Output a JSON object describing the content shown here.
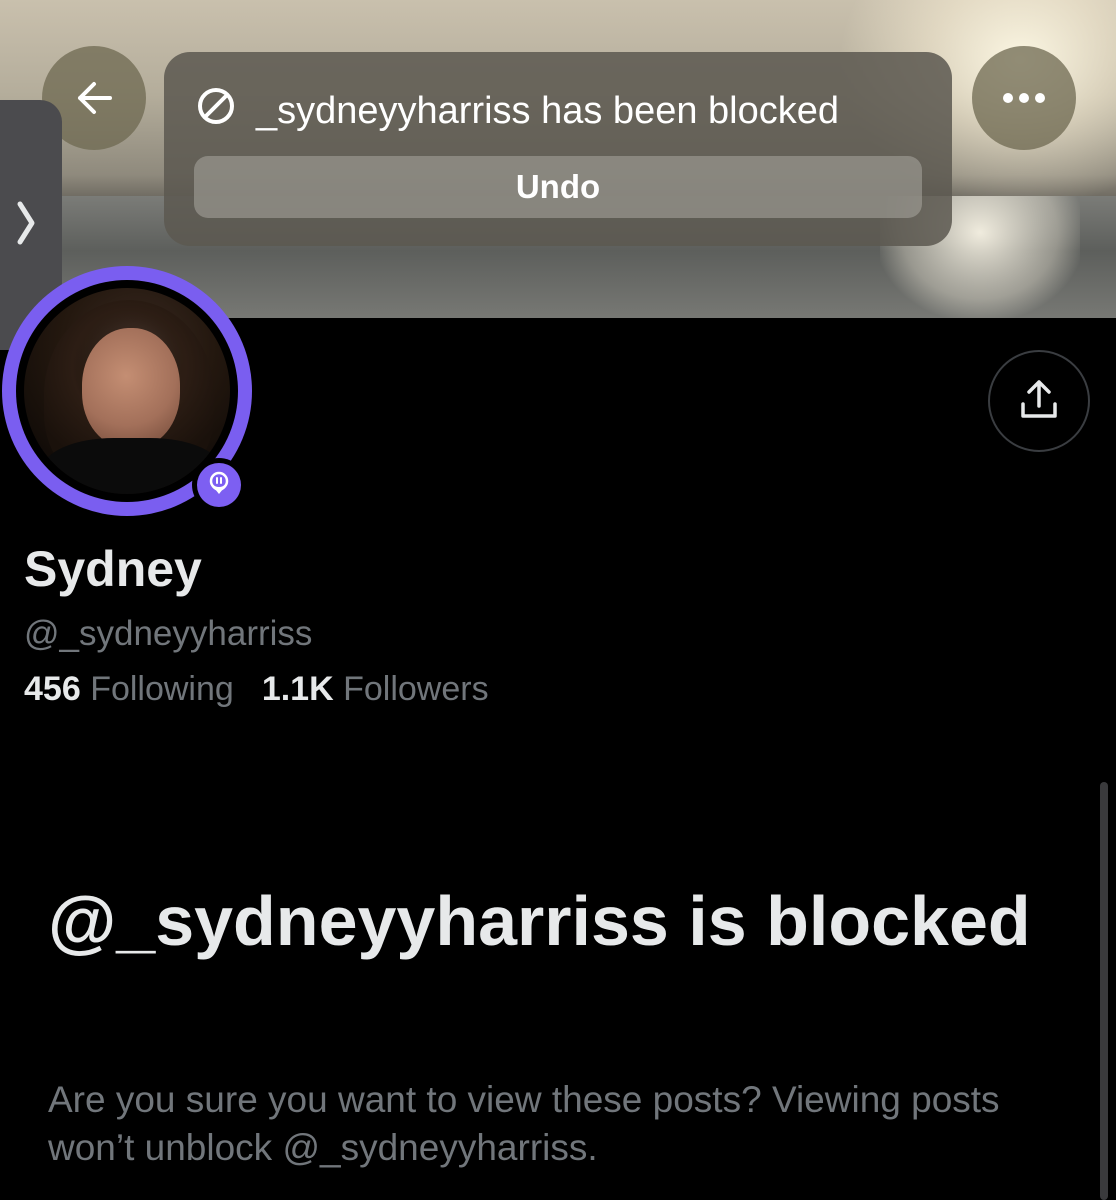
{
  "toast": {
    "message": "_sydneyyharriss has been blocked",
    "undo_label": "Undo"
  },
  "header": {
    "back_icon": "arrow-left-icon",
    "more_icon": "more-horizontal-icon"
  },
  "side_tab": {
    "icon": "chevron-right-icon"
  },
  "profile": {
    "display_name": "Sydney",
    "handle": "@_sydneyyharriss",
    "following_count": "456",
    "following_label": "Following",
    "followers_count": "1.1K",
    "followers_label": "Followers",
    "share_icon": "share-icon",
    "accent_color": "#7a5ef0"
  },
  "blocked_notice": {
    "title": "@_sydneyyharriss is blocked",
    "description": "Are you sure you want to view these posts? Viewing posts won’t unblock @_sydneyyharriss."
  }
}
